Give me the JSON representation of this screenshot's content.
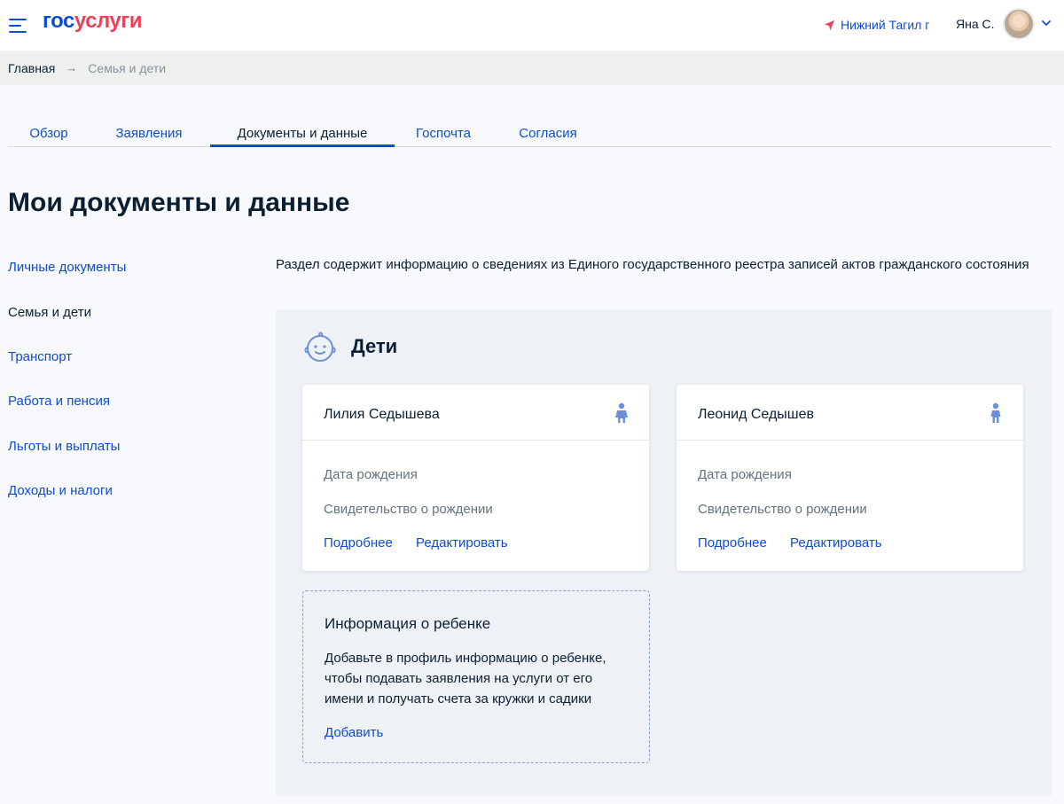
{
  "header": {
    "logo_part1": "гос",
    "logo_part2": "услуги",
    "location": "Нижний Тагил г",
    "user_name": "Яна С."
  },
  "breadcrumb": {
    "home": "Главная",
    "current": "Семья и дети"
  },
  "tabs": [
    {
      "label": "Обзор",
      "active": false
    },
    {
      "label": "Заявления",
      "active": false
    },
    {
      "label": "Документы и данные",
      "active": true
    },
    {
      "label": "Госпочта",
      "active": false
    },
    {
      "label": "Согласия",
      "active": false
    }
  ],
  "page_title": "Мои документы и данные",
  "side_menu": [
    {
      "label": "Личные документы",
      "current": false
    },
    {
      "label": "Семья и дети",
      "current": true
    },
    {
      "label": "Транспорт",
      "current": false
    },
    {
      "label": "Работа и пенсия",
      "current": false
    },
    {
      "label": "Льготы и выплаты",
      "current": false
    },
    {
      "label": "Доходы и налоги",
      "current": false
    }
  ],
  "description": "Раздел содержит информацию о сведениях из Единого государственного реестра записей актов гражданского состояния",
  "children_section": {
    "title": "Дети",
    "children": [
      {
        "name": "Лилия Седышева",
        "birth_date_label": "Дата рождения",
        "certificate_label": "Свидетельство о рождении",
        "more_link": "Подробнее",
        "edit_link": "Редактировать"
      },
      {
        "name": "Леонид Седышев",
        "birth_date_label": "Дата рождения",
        "certificate_label": "Свидетельство о рождении",
        "more_link": "Подробнее",
        "edit_link": "Редактировать"
      }
    ],
    "add_card": {
      "title": "Информация о ребенке",
      "text": "Добавьте в профиль информацию о ребенке, чтобы подавать заявления на услуги от его имени и получать счета за кружки и садики",
      "link": "Добавить"
    }
  },
  "colors": {
    "accent": "#0d4cd3",
    "brand_red": "#ee3f58",
    "text": "#0b1f33",
    "muted": "#66727f"
  },
  "icons": [
    "menu-icon",
    "location-arrow-icon",
    "avatar",
    "chevron-down-icon",
    "baby-face-icon",
    "person-icon"
  ]
}
